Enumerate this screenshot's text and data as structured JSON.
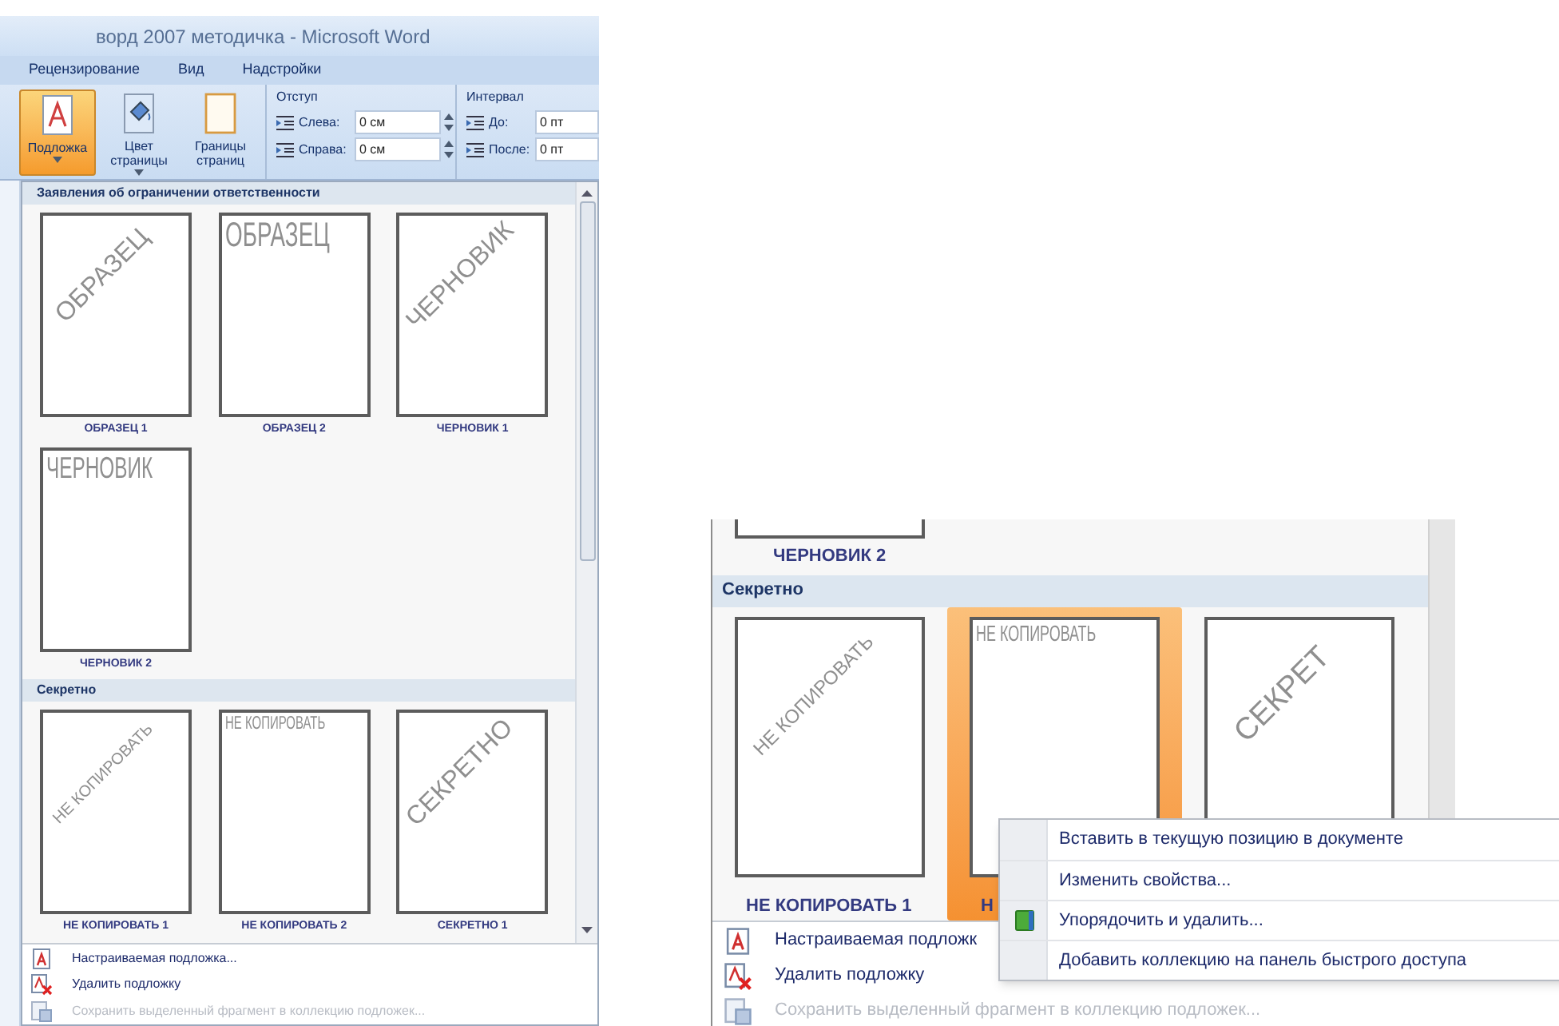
{
  "left": {
    "window": {
      "title": "ворд 2007 методичка - Microsoft Word"
    },
    "tabs": [
      {
        "label": "Рецензирование"
      },
      {
        "label": "Вид"
      },
      {
        "label": "Надстройки"
      }
    ],
    "ribbon": {
      "buttons": [
        {
          "label": "Подложка",
          "kind": "watermark",
          "selected": true,
          "dropdown": true
        },
        {
          "label": "Цвет страницы",
          "kind": "color",
          "selected": false,
          "dropdown": true
        },
        {
          "label": "Границы страниц",
          "kind": "borders",
          "selected": false,
          "dropdown": false
        }
      ],
      "groups": [
        {
          "title": "Отступ",
          "fields": [
            {
              "label": "Слева:",
              "value": "0 см"
            },
            {
              "label": "Справа:",
              "value": "0 см"
            }
          ]
        },
        {
          "title": "Интервал",
          "fields": [
            {
              "label": "До:",
              "value": "0 пт"
            },
            {
              "label": "После:",
              "value": "0 пт"
            }
          ]
        }
      ]
    },
    "gallery": {
      "sections": [
        {
          "title": "Заявления об ограничении ответственности",
          "items": [
            {
              "label": "ОБРАЗЕЦ 1",
              "preview": "ОБРАЗЕЦ",
              "kind": "diagonal",
              "selected": false
            },
            {
              "label": "ОБРАЗЕЦ 2",
              "preview": "ОБРАЗЕЦ",
              "kind": "horizontal",
              "selected": false
            },
            {
              "label": "ЧЕРНОВИК 1",
              "preview": "ЧЕРНОВИК",
              "kind": "diagonal",
              "selected": false
            },
            {
              "label": "ЧЕРНОВИК 2",
              "preview": "ЧЕРНОВИК",
              "kind": "horizontal",
              "selected": false
            }
          ]
        },
        {
          "title": "Секретно",
          "items": [
            {
              "label": "НЕ КОПИРОВАТЬ 1",
              "preview": "НЕ КОПИРОВАТЬ",
              "kind": "diagonal",
              "selected": false
            },
            {
              "label": "НЕ КОПИРОВАТЬ 2",
              "preview": "НЕ КОПИРОВАТЬ",
              "kind": "horizontal",
              "selected": false
            },
            {
              "label": "СЕКРЕТНО 1",
              "preview": "СЕКРЕТНО",
              "kind": "diagonal",
              "selected": false
            }
          ]
        }
      ]
    },
    "menu": [
      {
        "label": "Настраиваемая подложка...",
        "kind": "custom",
        "disabled": false
      },
      {
        "label": "Удалить подложку",
        "kind": "remove",
        "disabled": false
      },
      {
        "label": "Сохранить выделенный фрагмент в коллекцию подложек...",
        "kind": "save",
        "disabled": true
      }
    ]
  },
  "right": {
    "gallery": {
      "top_item": {
        "label": "ЧЕРНОВИК 2"
      },
      "sections": [
        {
          "title": "Секретно",
          "items": [
            {
              "label": "НЕ КОПИРОВАТЬ 1",
              "preview": "НЕ КОПИРОВАТЬ",
              "kind": "diagonal",
              "selected": false
            },
            {
              "label": "Н",
              "preview": "НЕ КОПИРОВАТЬ",
              "kind": "horizontal",
              "selected": true
            },
            {
              "preview": "СЕКРЕТ",
              "kind": "diagonal",
              "selected": false
            }
          ]
        }
      ]
    },
    "menu": [
      {
        "label": "Настраиваемая подложк",
        "kind": "custom",
        "disabled": false
      },
      {
        "label": "Удалить подложку",
        "kind": "remove",
        "disabled": false
      },
      {
        "label": "Сохранить выделенный фрагмент в коллекцию подложек...",
        "kind": "save",
        "disabled": true
      }
    ],
    "context_menu": [
      {
        "label": "Вставить в текущую позицию в документе",
        "icon": false
      },
      {
        "label": "Изменить свойства...",
        "icon": false
      },
      {
        "label": "Упорядочить и удалить...",
        "icon": true
      },
      {
        "label": "Добавить коллекцию на панель быстрого доступа",
        "icon": false
      }
    ]
  }
}
